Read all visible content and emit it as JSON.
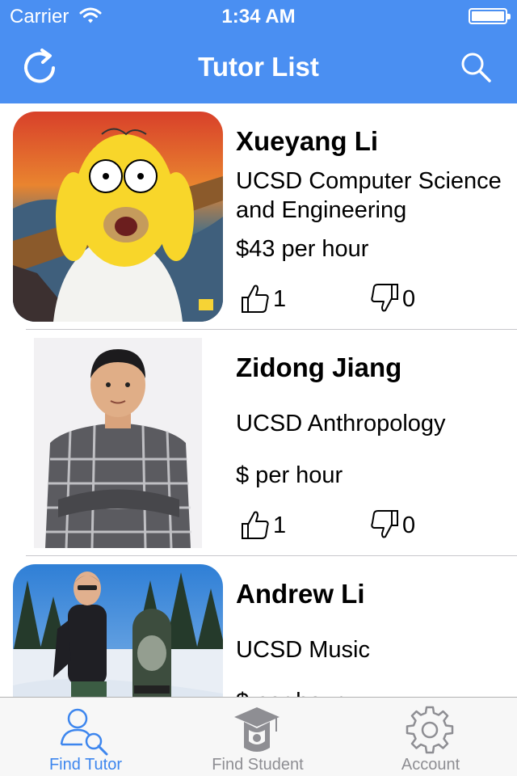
{
  "status_bar": {
    "carrier": "Carrier",
    "time": "1:34 AM"
  },
  "nav": {
    "title": "Tutor List",
    "left_icon": "refresh-icon",
    "right_icon": "search-icon"
  },
  "colors": {
    "accent": "#4a8ff2",
    "tab_active": "#3d86ee",
    "tab_inactive": "#8e8e93"
  },
  "tutors": [
    {
      "name": "Xueyang Li",
      "major": "UCSD Computer Science and Engineering",
      "rate": "$43 per hour",
      "likes": "1",
      "dislikes": "0"
    },
    {
      "name": "Zidong Jiang",
      "major": "UCSD Anthropology",
      "rate": "$ per hour",
      "likes": "1",
      "dislikes": "0"
    },
    {
      "name": "Andrew Li",
      "major": "UCSD Music",
      "rate": "$ per hour",
      "likes": "",
      "dislikes": ""
    }
  ],
  "tabs": [
    {
      "label": "Find Tutor",
      "icon": "find-tutor-icon",
      "active": true
    },
    {
      "label": "Find Student",
      "icon": "graduation-cap-icon",
      "active": false
    },
    {
      "label": "Account",
      "icon": "gear-icon",
      "active": false
    }
  ]
}
